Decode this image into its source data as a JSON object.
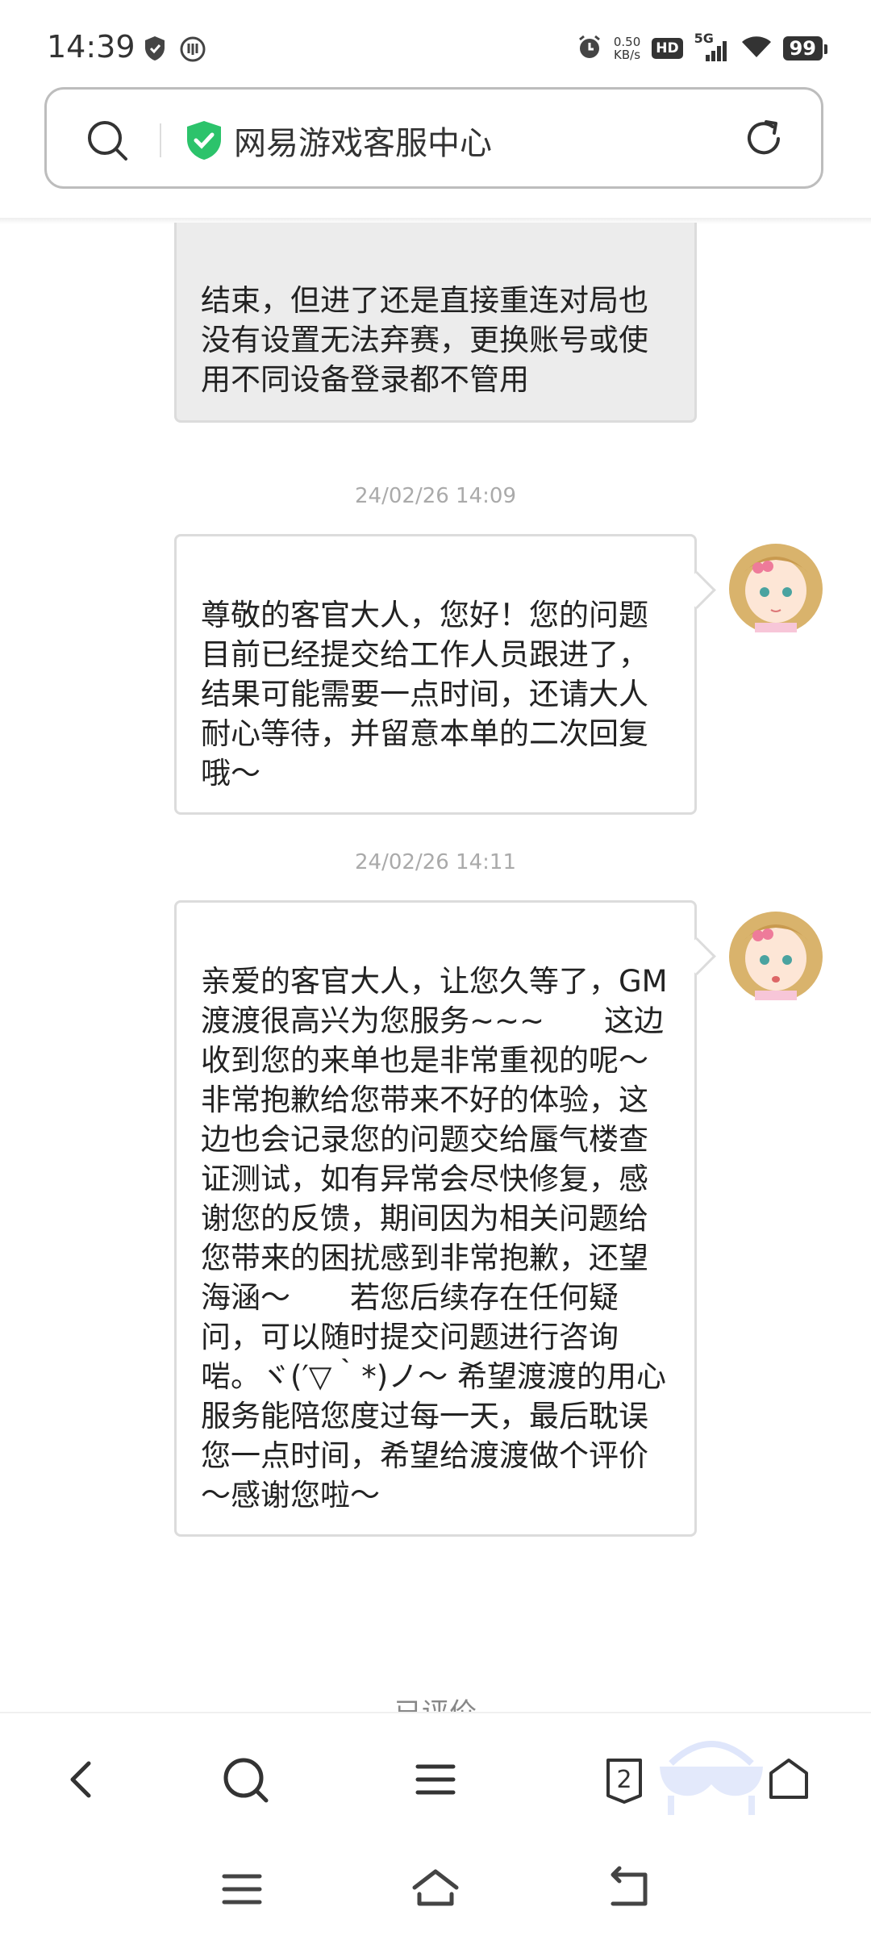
{
  "status_bar": {
    "time": "14:39",
    "net_speed_value": "0.50",
    "net_speed_unit": "KB/s",
    "hd": "HD",
    "network": "5G",
    "battery": "99",
    "icons": [
      "shield-icon",
      "vpn-icon",
      "alarm-icon",
      "signal-icon",
      "wifi-icon"
    ]
  },
  "address_bar": {
    "title": "网易游戏客服中心",
    "icons": [
      "search-icon",
      "verified-shield-icon",
      "reload-icon"
    ]
  },
  "chat": {
    "messages": [
      {
        "sender": "user",
        "text": "结束，但进了还是直接重连对局也没有设置无法弃赛，更换账号或使用不同设备登录都不管用"
      },
      {
        "sender": "agent",
        "timestamp": "24/02/26 14:09",
        "text": "尊敬的客官大人，您好！您的问题目前已经提交给工作人员跟进了，结果可能需要一点时间，还请大人耐心等待，并留意本单的二次回复哦～"
      },
      {
        "sender": "agent",
        "timestamp": "24/02/26 14:11",
        "text": "亲爱的客官大人，让您久等了，GM渡渡很高兴为您服务~~~　　这边收到您的来单也是非常重视的呢～　　非常抱歉给您带来不好的体验，这边也会记录您的问题交给蜃气楼查证测试，如有异常会尽快修复，感谢您的反馈，期间因为相关问题给您带来的困扰感到非常抱歉，还望海涵～　　若您后续存在任何疑问，可以随时提交问题进行咨询啱。ヾ(′▽｀*)ノ～ 希望渡渡的用心服务能陪您度过每一天，最后耽误您一点时间，希望给渡渡做个评价～感谢您啦～"
      }
    ],
    "rated_label": "已评价"
  },
  "toolbar": {
    "tab_count": "2",
    "icons": [
      "back-icon",
      "search-icon",
      "menu-icon",
      "tabs-icon",
      "home-icon"
    ]
  },
  "navbar": {
    "icons": [
      "recents-icon",
      "home-icon",
      "back-icon"
    ]
  }
}
